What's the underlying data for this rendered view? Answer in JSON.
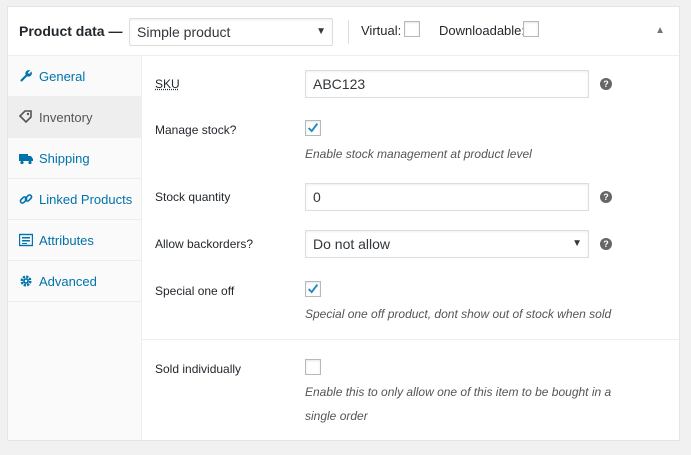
{
  "header": {
    "title": "Product data —",
    "product_type": "Simple product",
    "virtual_label": "Virtual:",
    "downloadable_label": "Downloadable:"
  },
  "tabs": [
    {
      "label": "General",
      "icon": "wrench-icon"
    },
    {
      "label": "Inventory",
      "icon": "tag-icon"
    },
    {
      "label": "Shipping",
      "icon": "truck-icon"
    },
    {
      "label": "Linked Products",
      "icon": "link-icon"
    },
    {
      "label": "Attributes",
      "icon": "list-icon"
    },
    {
      "label": "Advanced",
      "icon": "gear-icon"
    }
  ],
  "inventory": {
    "sku_label": "SKU",
    "sku_value": "ABC123",
    "manage_stock_label": "Manage stock?",
    "manage_stock_desc": "Enable stock management at product level",
    "stock_qty_label": "Stock quantity",
    "stock_qty_value": "0",
    "backorders_label": "Allow backorders?",
    "backorders_value": "Do not allow",
    "special_label": "Special one off",
    "special_desc": "Special one off product, dont show out of stock when sold",
    "sold_ind_label": "Sold individually",
    "sold_ind_desc_1": "Enable this to only allow one of this item to be bought in a",
    "sold_ind_desc_2": "single order"
  },
  "colors": {
    "accent": "#0073aa",
    "checkmark": "#1e8cbe"
  }
}
